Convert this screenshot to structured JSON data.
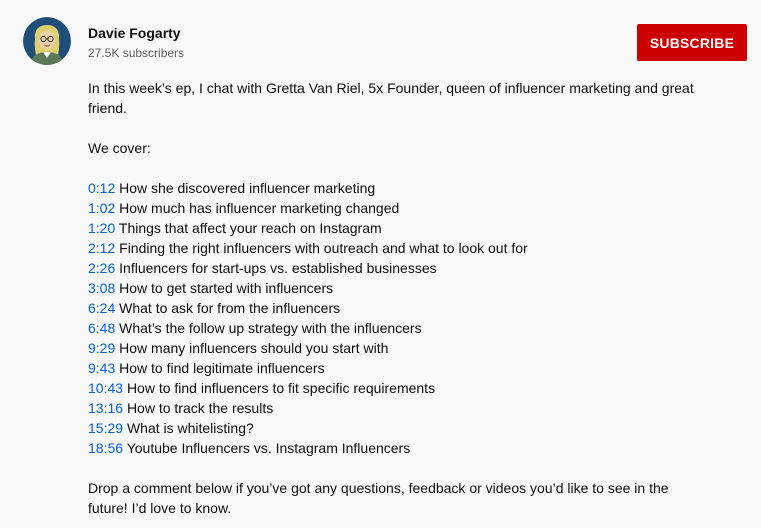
{
  "channel": {
    "name": "Davie Fogarty",
    "subscribers": "27.5K subscribers"
  },
  "subscribe": {
    "label": "SUBSCRIBE",
    "color": "#cc0000"
  },
  "link_color": "#065fd4",
  "description": {
    "intro": "In this week’s ep, I chat with Gretta Van Riel, 5x Founder, queen of influencer marketing and great friend.",
    "we_cover": "We cover:",
    "chapters": [
      {
        "time": "0:12",
        "title": "How she discovered influencer marketing"
      },
      {
        "time": "1:02",
        "title": "How much has influencer marketing changed"
      },
      {
        "time": "1:20",
        "title": "Things that affect your reach on Instagram"
      },
      {
        "time": "2:12",
        "title": "Finding the right influencers with outreach and what to look out for"
      },
      {
        "time": "2:26",
        "title": "Influencers for start-ups vs. established businesses"
      },
      {
        "time": "3:08",
        "title": "How to get started with influencers"
      },
      {
        "time": "6:24",
        "title": "What to ask for from the influencers"
      },
      {
        "time": "6:48",
        "title": "What’s the follow up strategy with the influencers"
      },
      {
        "time": "9:29",
        "title": "How many influencers should you start with"
      },
      {
        "time": "9:43",
        "title": "How to find legitimate influencers"
      },
      {
        "time": "10:43",
        "title": "How to find influencers to fit specific requirements"
      },
      {
        "time": "13:16",
        "title": "How to track the results"
      },
      {
        "time": "15:29",
        "title": "What is whitelisting?"
      },
      {
        "time": "18:56",
        "title": "Youtube Influencers vs. Instagram Influencers"
      }
    ],
    "outro": "Drop a comment below if you’ve got any questions, feedback or videos you’d like to see in the future! I’d love to know."
  }
}
